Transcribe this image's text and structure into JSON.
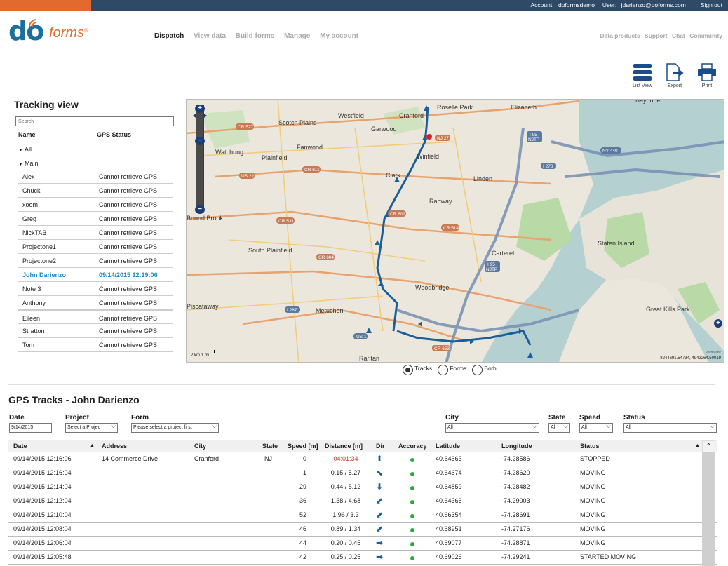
{
  "topbar": {
    "account_label": "Account:",
    "account": "doformsdemo",
    "user_label": "| User:",
    "user": "jdarienzo@doforms.com",
    "signout": "Sign out"
  },
  "logo": {
    "do": "do",
    "forms": "forms",
    "registered": "®"
  },
  "nav": {
    "main": [
      "Dispatch",
      "View data",
      "Build forms",
      "Manage",
      "My account"
    ],
    "active": "Dispatch",
    "right": [
      "Data products",
      "Support",
      "Chat",
      "Community"
    ]
  },
  "tools": [
    {
      "label": "List View",
      "icon": "list-view-icon"
    },
    {
      "label": "Export",
      "icon": "export-icon"
    },
    {
      "label": "Print",
      "icon": "print-icon"
    }
  ],
  "tracking": {
    "title": "Tracking view",
    "search_placeholder": "Search",
    "col_name": "Name",
    "col_status": "GPS Status",
    "groups": [
      "All",
      "Main"
    ],
    "users": [
      {
        "name": "Alex",
        "status": "Cannot retrieve GPS"
      },
      {
        "name": "Chuck",
        "status": "Cannot retrieve GPS"
      },
      {
        "name": "xoom",
        "status": "Cannot retrieve GPS"
      },
      {
        "name": "Greg",
        "status": "Cannot retrieve GPS"
      },
      {
        "name": "NickTAB",
        "status": "Cannot retrieve GPS"
      },
      {
        "name": "Projectone1",
        "status": "Cannot retrieve GPS"
      },
      {
        "name": "Projectone2",
        "status": "Cannot retrieve GPS"
      },
      {
        "name": "John Darienzo",
        "status": "09/14/2015 12:19:06",
        "active": true
      },
      {
        "name": "Note 3",
        "status": "Cannot retrieve GPS"
      },
      {
        "name": "Anthony",
        "status": "Cannot retrieve GPS"
      },
      {
        "name": "Eileen",
        "status": "Cannot retrieve GPS"
      },
      {
        "name": "Stratton",
        "status": "Cannot retrieve GPS"
      },
      {
        "name": "Tom",
        "status": "Cannot retrieve GPS"
      }
    ]
  },
  "map": {
    "places": [
      "Roselle Park",
      "Elizabeth",
      "Bayonne",
      "Cranford",
      "Westfield",
      "Scotch Plains",
      "Garwood",
      "Fanwood",
      "Plainfield",
      "Watchung",
      "Clark",
      "Winfield",
      "Linden",
      "Rahway",
      "South Plainfield",
      "Carteret",
      "Staten Island",
      "Woodbridge",
      "Metuchen",
      "Piscataway",
      "Great Kills Park",
      "Raritan",
      "Bound Brook"
    ],
    "roads": [
      "CR 527",
      "NJ 27",
      "I 95 NJTP",
      "I 278",
      "NY 440",
      "US 22",
      "CR 611",
      "(655)",
      "CR 602",
      "CR 514",
      "CR 531",
      "(603)",
      "CR 604",
      "CR 529",
      "CR 603",
      "I 287",
      "US 1",
      "CR 653",
      "(656)",
      "CR 609",
      "CR 605",
      "I 78"
    ],
    "scale": "2 km",
    "scale2": "1 mi",
    "credit": "Permalink",
    "coords": "-8244691.54734, 4942264.50019",
    "view_options": [
      "Tracks",
      "Forms",
      "Both"
    ],
    "view_selected": "Tracks"
  },
  "gps": {
    "title": "GPS Tracks - John Darienzo",
    "filters": {
      "date_label": "Date",
      "date_value": "9/14/2015",
      "project_label": "Project",
      "project_value": "Select a Projec",
      "form_label": "Form",
      "form_value": "Please select a project first",
      "city_label": "City",
      "city_value": "All",
      "state_label": "State",
      "state_value": "Al",
      "speed_label": "Speed",
      "speed_value": "All",
      "status_label": "Status",
      "status_value": "All"
    },
    "columns": [
      "Date",
      "Address",
      "City",
      "State",
      "Speed [m]",
      "Distance [m]",
      "Dir",
      "Accuracy",
      "Latitude",
      "Longitude",
      "Status"
    ],
    "rows": [
      {
        "date": "09/14/2015 12:16:06",
        "address": "14 Commerce Drive",
        "city": "Cranford",
        "state": "NJ",
        "speed": "0",
        "distance": "04:01:34",
        "dir": "up",
        "lat": "40.64663",
        "lon": "-74.28586",
        "status": "STOPPED"
      },
      {
        "date": "09/14/2015 12:16:04",
        "address": "",
        "city": "",
        "state": "",
        "speed": "1",
        "distance": "0.15 / 5.27",
        "dir": "upleft",
        "lat": "40.64674",
        "lon": "-74.28620",
        "status": "MOVING"
      },
      {
        "date": "09/14/2015 12:14:04",
        "address": "",
        "city": "",
        "state": "",
        "speed": "29",
        "distance": "0.44 / 5.12",
        "dir": "down",
        "lat": "40.64859",
        "lon": "-74.28482",
        "status": "MOVING"
      },
      {
        "date": "09/14/2015 12:12:04",
        "address": "",
        "city": "",
        "state": "",
        "speed": "36",
        "distance": "1.38 / 4.68",
        "dir": "downleft",
        "lat": "40.64366",
        "lon": "-74.29003",
        "status": "MOVING"
      },
      {
        "date": "09/14/2015 12:10:04",
        "address": "",
        "city": "",
        "state": "",
        "speed": "52",
        "distance": "1.96 / 3.3",
        "dir": "downleft",
        "lat": "40.66354",
        "lon": "-74.28691",
        "status": "MOVING"
      },
      {
        "date": "09/14/2015 12:08:04",
        "address": "",
        "city": "",
        "state": "",
        "speed": "46",
        "distance": "0.89 / 1.34",
        "dir": "downleft",
        "lat": "40.68951",
        "lon": "-74.27176",
        "status": "MOVING"
      },
      {
        "date": "09/14/2015 12:06:04",
        "address": "",
        "city": "",
        "state": "",
        "speed": "44",
        "distance": "0.20 / 0.45",
        "dir": "right",
        "lat": "40.69077",
        "lon": "-74.28871",
        "status": "MOVING"
      },
      {
        "date": "09/14/2015 12:05:48",
        "address": "",
        "city": "",
        "state": "",
        "speed": "42",
        "distance": "0.25 / 0.25",
        "dir": "right",
        "lat": "40.69026",
        "lon": "-74.29241",
        "status": "STARTED MOVING"
      }
    ]
  },
  "colors": {
    "accent": "#e36a2e",
    "topbar": "#2f4a66",
    "brand": "#1b6f9c",
    "active_user": "#1e8ac6",
    "track": "#1a5f99"
  }
}
